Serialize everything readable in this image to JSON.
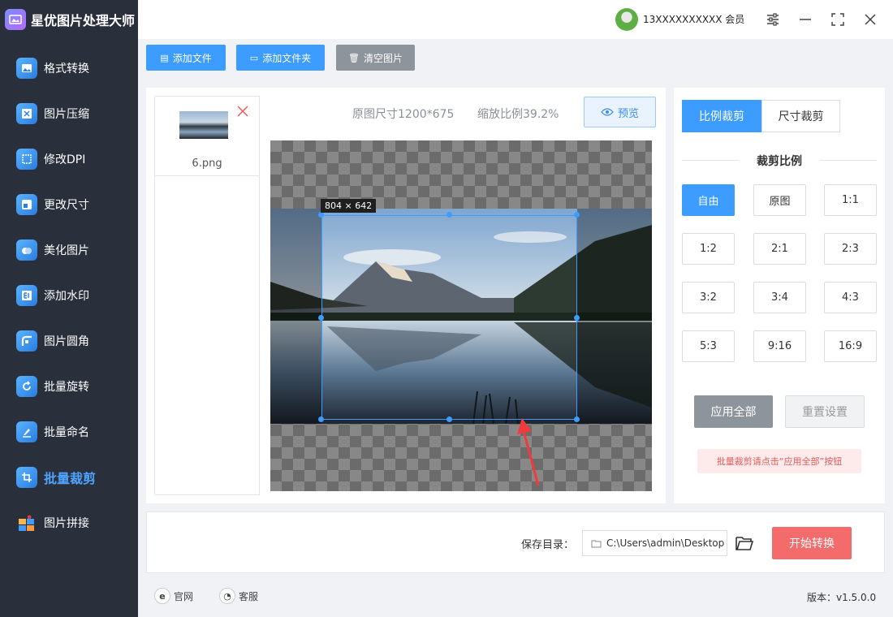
{
  "app": {
    "title": "星优图片处理大师"
  },
  "user": {
    "name": "13XXXXXXXXXX 会员"
  },
  "sidebar": {
    "items": [
      {
        "label": "格式转换"
      },
      {
        "label": "图片压缩"
      },
      {
        "label": "修改DPI"
      },
      {
        "label": "更改尺寸"
      },
      {
        "label": "美化图片"
      },
      {
        "label": "添加水印"
      },
      {
        "label": "图片圆角"
      },
      {
        "label": "批量旋转"
      },
      {
        "label": "批量命名"
      },
      {
        "label": "批量裁剪"
      },
      {
        "label": "图片拼接"
      }
    ],
    "active_index": 9
  },
  "toolbar": {
    "add_file": "添加文件",
    "add_folder": "添加文件夹",
    "clear": "清空图片"
  },
  "files": [
    {
      "name": "6.png"
    }
  ],
  "preview": {
    "original_size": "原图尺寸1200*675",
    "zoom": "缩放比例39.2%",
    "preview_label": "预览",
    "crop_size": "804 × 642"
  },
  "crop_panel": {
    "tab_ratio": "比例裁剪",
    "tab_size": "尺寸裁剪",
    "section_title": "裁剪比例",
    "ratios": [
      "自由",
      "原图",
      "1:1",
      "1:2",
      "2:1",
      "2:3",
      "3:2",
      "3:4",
      "4:3",
      "5:3",
      "9:16",
      "16:9"
    ],
    "selected_ratio": "自由",
    "apply_all": "应用全部",
    "reset": "重置设置",
    "tip": "批量裁剪请点击“应用全部”按钮"
  },
  "output": {
    "save_label": "保存目录：",
    "save_path": "C:\\Users\\admin\\Desktop",
    "start_button": "开始转换"
  },
  "footer": {
    "website": "官网",
    "support": "客服",
    "version": "版本：v1.5.0.0"
  },
  "colors": {
    "sidebar_bg": "#2a2f3c",
    "accent": "#3d9cff",
    "start_button": "#f36b6b"
  }
}
